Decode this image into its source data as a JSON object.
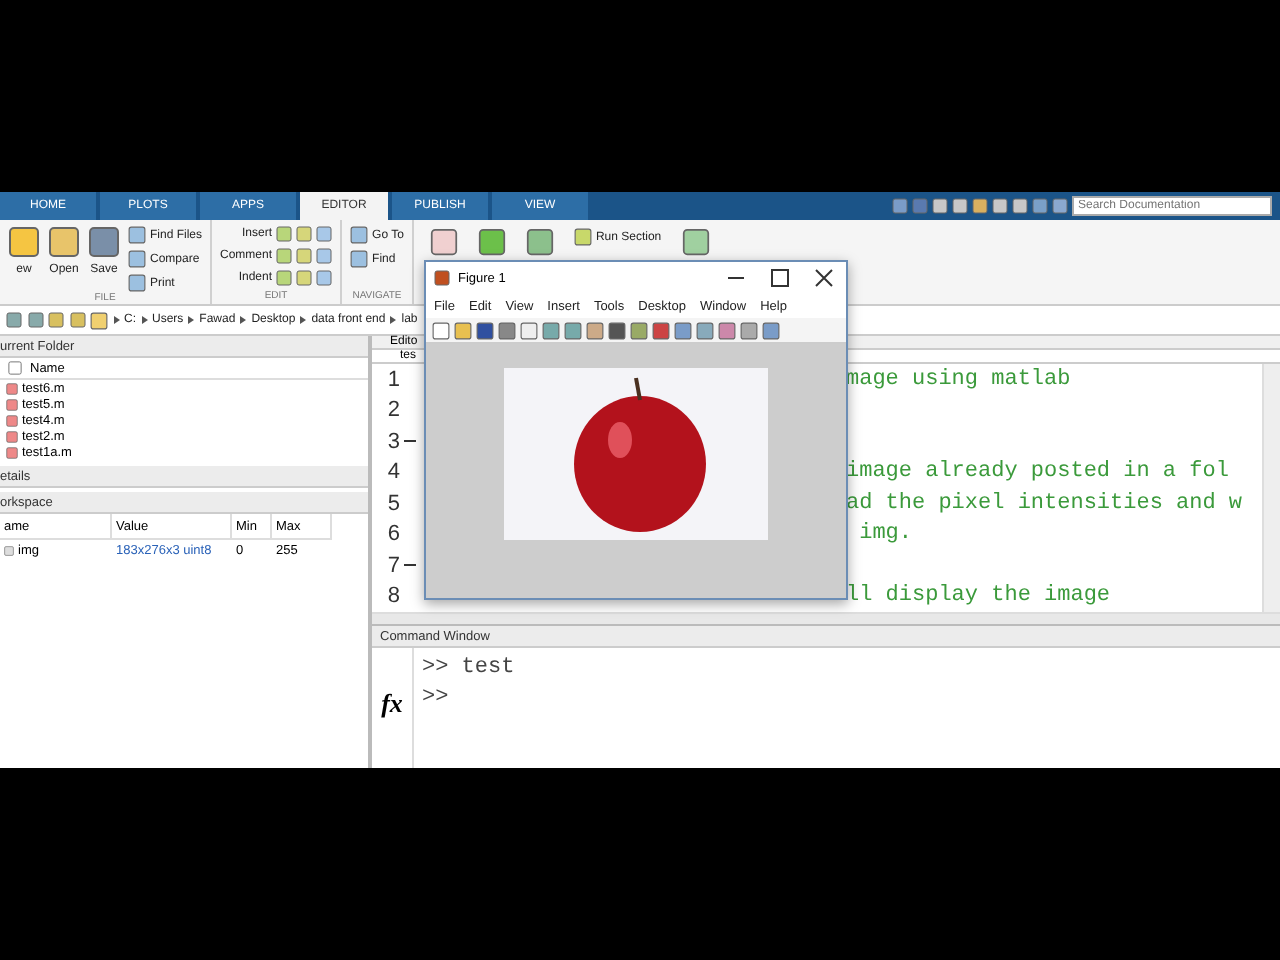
{
  "tabs": [
    {
      "label": "HOME",
      "selected": false
    },
    {
      "label": "PLOTS",
      "selected": false
    },
    {
      "label": "APPS",
      "selected": false
    },
    {
      "label": "EDITOR",
      "selected": true
    },
    {
      "label": "PUBLISH",
      "selected": false
    },
    {
      "label": "VIEW",
      "selected": false
    }
  ],
  "search": {
    "placeholder": "Search Documentation"
  },
  "ribbon": {
    "groups": [
      {
        "label": "FILE",
        "buttons": [
          {
            "label": "ew",
            "kind": "large"
          },
          {
            "label": "Open",
            "kind": "large"
          },
          {
            "label": "Save",
            "kind": "large"
          },
          {
            "label": "Find Files",
            "kind": "small"
          },
          {
            "label": "Compare",
            "kind": "small"
          },
          {
            "label": "Print",
            "kind": "small"
          }
        ]
      },
      {
        "label": "EDIT",
        "buttons": [
          {
            "label": "Insert",
            "kind": "row"
          },
          {
            "label": "Comment",
            "kind": "row"
          },
          {
            "label": "Indent",
            "kind": "row"
          }
        ]
      },
      {
        "label": "NAVIGATE",
        "buttons": [
          {
            "label": "Go To",
            "kind": "small"
          },
          {
            "label": "Find",
            "kind": "small"
          }
        ]
      }
    ],
    "run_section": "Run Section"
  },
  "path": [
    "C:",
    "Users",
    "Fawad",
    "Desktop",
    "data front end",
    "lab"
  ],
  "current_folder": {
    "title": "urrent Folder",
    "column": "Name",
    "files": [
      "test6.m",
      "test5.m",
      "test4.m",
      "test2.m",
      "test1a.m"
    ]
  },
  "details": {
    "title": "etails"
  },
  "workspace": {
    "title": "orkspace",
    "columns": [
      "ame",
      "Value",
      "Min",
      "Max"
    ],
    "rows": [
      {
        "name": "img",
        "value": "183x276x3 uint8",
        "min": "0",
        "max": "255"
      }
    ]
  },
  "editor": {
    "title": "Edito",
    "tab": "tes",
    "lines": [
      {
        "number": "1",
        "dash": false,
        "code": "mage using matlab"
      },
      {
        "number": "2",
        "dash": false
      },
      {
        "number": "3",
        "dash": true
      },
      {
        "number": "4",
        "dash": false,
        "code": "image already posted in a fol"
      },
      {
        "number": "5",
        "dash": false,
        "code": "ad the pixel intensities and w"
      },
      {
        "number": "6",
        "dash": false,
        "code": " img."
      },
      {
        "number": "7",
        "dash": true
      },
      {
        "number": "8",
        "dash": false,
        "code": "ll display the image"
      }
    ]
  },
  "figure": {
    "title": "Figure 1",
    "menu": [
      "File",
      "Edit",
      "View",
      "Insert",
      "Tools",
      "Desktop",
      "Window",
      "Help"
    ]
  },
  "command_window": {
    "title": "Command Window",
    "prompt_icon": "fx",
    "lines": [
      ">> test",
      ">>"
    ]
  }
}
